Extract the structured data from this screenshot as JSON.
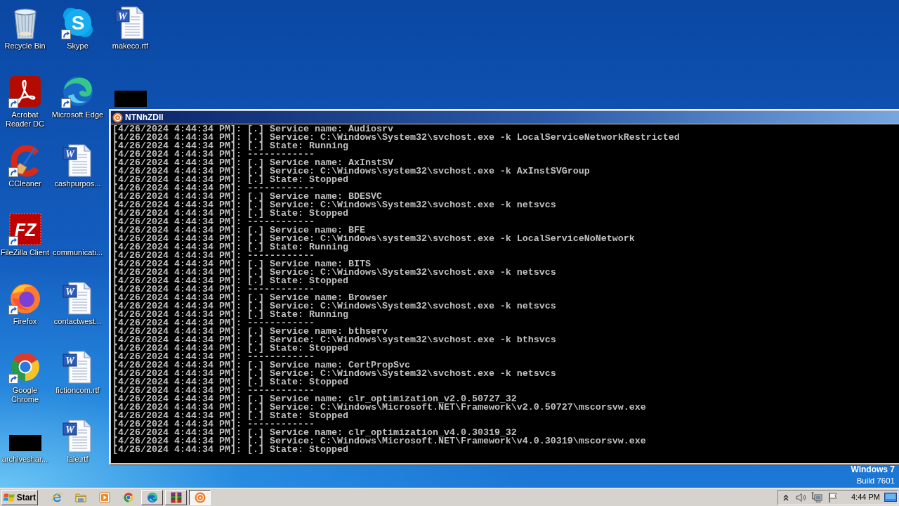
{
  "desktop_icons": [
    {
      "kind": "recycle",
      "label": "Recycle Bin",
      "shortcut": false
    },
    {
      "kind": "acrobat",
      "label": "Acrobat Reader DC",
      "shortcut": true
    },
    {
      "kind": "ccleaner",
      "label": "CCleaner",
      "shortcut": true
    },
    {
      "kind": "filezilla",
      "label": "FileZilla Client",
      "shortcut": true,
      "glyph": "FZ"
    },
    {
      "kind": "firefox",
      "label": "Firefox",
      "shortcut": true
    },
    {
      "kind": "chrome",
      "label": "Google Chrome",
      "shortcut": true
    },
    {
      "kind": "redacted",
      "label": "archiveshar...",
      "shortcut": false
    },
    {
      "kind": "skype",
      "label": "Skype",
      "shortcut": true,
      "glyph": "S"
    },
    {
      "kind": "edge",
      "label": "Microsoft Edge",
      "shortcut": true
    },
    {
      "kind": "word",
      "label": "cashpurpos...",
      "shortcut": false,
      "glyph": "W"
    },
    {
      "kind": "blank",
      "label": "communicati...",
      "shortcut": false
    },
    {
      "kind": "word",
      "label": "contactwest...",
      "shortcut": false,
      "glyph": "W"
    },
    {
      "kind": "word",
      "label": "fictioncom.rtf",
      "shortcut": false,
      "glyph": "W"
    },
    {
      "kind": "word",
      "label": "laie.rtf",
      "shortcut": false,
      "glyph": "W"
    },
    {
      "kind": "word",
      "label": "makeco.rtf",
      "shortcut": false,
      "glyph": "W"
    },
    {
      "kind": "redacted",
      "shortcut": false
    }
  ],
  "console_window": {
    "title": "NTNhZDll",
    "lines": [
      "[4/26/2024 4:44:34 PM]: [.] Service name: Audiosrv",
      "[4/26/2024 4:44:34 PM]: [.] Service: C:\\Windows\\System32\\svchost.exe -k LocalServiceNetworkRestricted",
      "[4/26/2024 4:44:34 PM]: [.] State: Running",
      "[4/26/2024 4:44:34 PM]: ------------",
      "[4/26/2024 4:44:34 PM]: [.] Service name: AxInstSV",
      "[4/26/2024 4:44:34 PM]: [.] Service: C:\\Windows\\system32\\svchost.exe -k AxInstSVGroup",
      "[4/26/2024 4:44:34 PM]: [.] State: Stopped",
      "[4/26/2024 4:44:34 PM]: ------------",
      "[4/26/2024 4:44:34 PM]: [.] Service name: BDESVC",
      "[4/26/2024 4:44:34 PM]: [.] Service: C:\\Windows\\System32\\svchost.exe -k netsvcs",
      "[4/26/2024 4:44:34 PM]: [.] State: Stopped",
      "[4/26/2024 4:44:34 PM]: ------------",
      "[4/26/2024 4:44:34 PM]: [.] Service name: BFE",
      "[4/26/2024 4:44:34 PM]: [.] Service: C:\\Windows\\system32\\svchost.exe -k LocalServiceNoNetwork",
      "[4/26/2024 4:44:34 PM]: [.] State: Running",
      "[4/26/2024 4:44:34 PM]: ------------",
      "[4/26/2024 4:44:34 PM]: [.] Service name: BITS",
      "[4/26/2024 4:44:34 PM]: [.] Service: C:\\Windows\\System32\\svchost.exe -k netsvcs",
      "[4/26/2024 4:44:34 PM]: [.] State: Stopped",
      "[4/26/2024 4:44:34 PM]: ------------",
      "[4/26/2024 4:44:34 PM]: [.] Service name: Browser",
      "[4/26/2024 4:44:34 PM]: [.] Service: C:\\Windows\\System32\\svchost.exe -k netsvcs",
      "[4/26/2024 4:44:34 PM]: [.] State: Running",
      "[4/26/2024 4:44:34 PM]: ------------",
      "[4/26/2024 4:44:34 PM]: [.] Service name: bthserv",
      "[4/26/2024 4:44:34 PM]: [.] Service: C:\\Windows\\system32\\svchost.exe -k bthsvcs",
      "[4/26/2024 4:44:34 PM]: [.] State: Stopped",
      "[4/26/2024 4:44:34 PM]: ------------",
      "[4/26/2024 4:44:34 PM]: [.] Service name: CertPropSvc",
      "[4/26/2024 4:44:34 PM]: [.] Service: C:\\Windows\\System32\\svchost.exe -k netsvcs",
      "[4/26/2024 4:44:34 PM]: [.] State: Stopped",
      "[4/26/2024 4:44:34 PM]: ------------",
      "[4/26/2024 4:44:34 PM]: [.] Service name: clr_optimization_v2.0.50727_32",
      "[4/26/2024 4:44:34 PM]: [.] Service: C:\\Windows\\Microsoft.NET\\Framework\\v2.0.50727\\mscorsvw.exe",
      "[4/26/2024 4:44:34 PM]: [.] State: Stopped",
      "[4/26/2024 4:44:34 PM]: ------------",
      "[4/26/2024 4:44:34 PM]: [.] Service name: clr_optimization_v4.0.30319_32",
      "[4/26/2024 4:44:34 PM]: [.] Service: C:\\Windows\\Microsoft.NET\\Framework\\v4.0.30319\\mscorsvw.exe",
      "[4/26/2024 4:44:34 PM]: [.] State: Stopped"
    ]
  },
  "os_version": {
    "name": "Windows 7",
    "build": "Build 7601"
  },
  "taskbar": {
    "start_label": "Start",
    "quick_launch": [
      {
        "kind": "ie"
      },
      {
        "kind": "folder"
      },
      {
        "kind": "media"
      },
      {
        "kind": "chrome"
      }
    ],
    "buttons": [
      {
        "kind": "edge",
        "selected": false
      },
      {
        "kind": "winrar",
        "selected": false
      },
      {
        "kind": "app",
        "selected": true
      }
    ],
    "clock": "4:44 PM"
  }
}
